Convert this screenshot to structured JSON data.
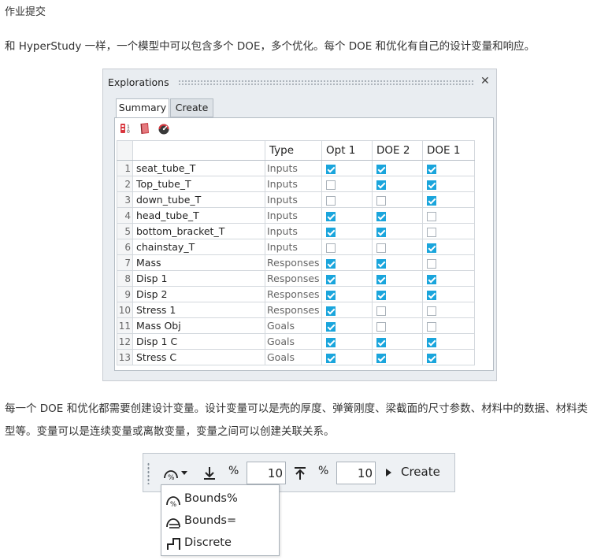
{
  "heading": "作业提交",
  "paragraph1": "和 HyperStudy 一样，一个模型中可以包含多个 DOE，多个优化。每个 DOE 和优化有自己的设计变量和响应。",
  "paragraph2": "每一个 DOE 和优化都需要创建设计变量。设计变量可以是壳的厚度、弹簧刚度、梁截面的尺寸参数、材料中的数据、材料类型等。变量可以是连续变量或离散变量，变量之间可以创建关联关系。",
  "panel": {
    "title": "Explorations",
    "close_icon": "✕",
    "tabs": [
      {
        "label": "Summary",
        "active": true
      },
      {
        "label": "Create",
        "active": false
      }
    ],
    "toolbar_icons": [
      "variables-toggle-icon",
      "book-icon",
      "gauge-icon"
    ],
    "columns": [
      "Type",
      "Opt 1",
      "DOE 2",
      "DOE 1"
    ],
    "rows": [
      {
        "num": "1",
        "name": "seat_tube_T",
        "type": "Inputs",
        "checks": [
          true,
          true,
          true
        ]
      },
      {
        "num": "2",
        "name": "Top_tube_T",
        "type": "Inputs",
        "checks": [
          false,
          true,
          true
        ]
      },
      {
        "num": "3",
        "name": "down_tube_T",
        "type": "Inputs",
        "checks": [
          false,
          false,
          true
        ]
      },
      {
        "num": "4",
        "name": "head_tube_T",
        "type": "Inputs",
        "checks": [
          true,
          true,
          false
        ]
      },
      {
        "num": "5",
        "name": "bottom_bracket_T",
        "type": "Inputs",
        "checks": [
          true,
          true,
          false
        ]
      },
      {
        "num": "6",
        "name": "chainstay_T",
        "type": "Inputs",
        "checks": [
          false,
          false,
          true
        ]
      },
      {
        "num": "7",
        "name": "Mass",
        "type": "Responses",
        "checks": [
          true,
          true,
          false
        ]
      },
      {
        "num": "8",
        "name": "Disp 1",
        "type": "Responses",
        "checks": [
          true,
          true,
          true
        ]
      },
      {
        "num": "9",
        "name": "Disp 2",
        "type": "Responses",
        "checks": [
          true,
          true,
          true
        ]
      },
      {
        "num": "10",
        "name": "Stress 1",
        "type": "Responses",
        "checks": [
          true,
          false,
          false
        ]
      },
      {
        "num": "11",
        "name": "Mass Obj",
        "type": "Goals",
        "checks": [
          true,
          false,
          false
        ]
      },
      {
        "num": "12",
        "name": "Disp 1 C",
        "type": "Goals",
        "checks": [
          true,
          true,
          true
        ]
      },
      {
        "num": "13",
        "name": "Stress C",
        "type": "Goals",
        "checks": [
          true,
          true,
          true
        ]
      }
    ],
    "accent_color": "#1aa5dc"
  },
  "variable_toolbar": {
    "bounds_pct_icon": "bounds-percent-icon",
    "lower_bound_pct_label": "%",
    "lower_bound_value": "10",
    "upper_bound_pct_label": "%",
    "upper_bound_value": "10",
    "create_label": "Create",
    "menu_items": [
      {
        "label": "Bounds%",
        "icon": "bounds-percent-icon"
      },
      {
        "label": "Bounds=",
        "icon": "bounds-equal-icon"
      },
      {
        "label": "Discrete",
        "icon": "discrete-step-icon"
      }
    ]
  }
}
